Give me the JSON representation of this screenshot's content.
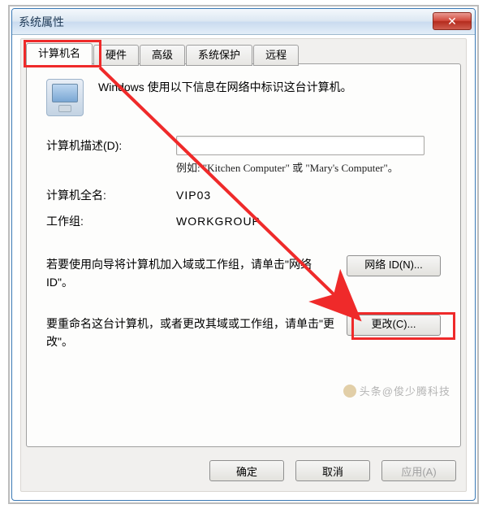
{
  "window": {
    "title": "系统属性"
  },
  "tabs": {
    "computer_name": "计算机名",
    "hardware": "硬件",
    "advanced": "高级",
    "system_protection": "系统保护",
    "remote": "远程"
  },
  "content": {
    "intro": "Windows 使用以下信息在网络中标识这台计算机。",
    "desc_label": "计算机描述(D):",
    "desc_value": "",
    "example": "例如:  \"Kitchen Computer\"  或  \"Mary's Computer\"。",
    "fullname_label": "计算机全名:",
    "fullname_value": "VIP03",
    "workgroup_label": "工作组:",
    "workgroup_value": "WORKGROUP",
    "network_id_text": "若要使用向导将计算机加入域或工作组，请单击\"网络 ID\"。",
    "network_id_btn": "网络 ID(N)...",
    "change_text": "要重命名这台计算机，或者更改其域或工作组，请单击\"更改\"。",
    "change_btn": "更改(C)..."
  },
  "footer": {
    "ok": "确定",
    "cancel": "取消",
    "apply": "应用(A)"
  },
  "watermark": "头条@俊少腾科技"
}
